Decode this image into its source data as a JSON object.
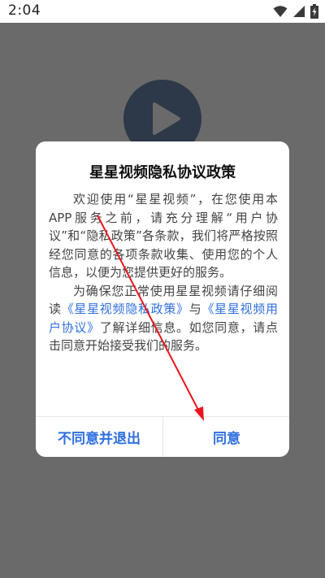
{
  "status_bar": {
    "time": "2:04",
    "icons": [
      "wifi-icon",
      "signal-icon",
      "battery-charging-icon"
    ]
  },
  "background": {
    "logo_icon": "play-icon",
    "overlay_color": "#6a6a6a"
  },
  "dialog": {
    "title": "星星视频隐私协议政策",
    "paragraph1": "欢迎使用“星星视频”，在您使用本APP服务之前，请充分理解“用户协议”和“隐私政策”各条款，我们将严格按照经您同意的各项条款收集、使用您的个人信息，以便为您提供更好的服务。",
    "paragraph2_prefix": "为确保您正常使用星星视频请仔细阅读",
    "privacy_link": "《星星视频隐私政策》",
    "paragraph2_and": "与",
    "user_agreement_link": "《星星视频用户协议》",
    "paragraph2_suffix": "了解详细信息。如您同意，请点击同意开始接受我们的服务。",
    "decline_label": "不同意并退出",
    "agree_label": "同意"
  },
  "colors": {
    "accent": "#2f6fe0",
    "annotation_arrow": "#e8161c"
  }
}
